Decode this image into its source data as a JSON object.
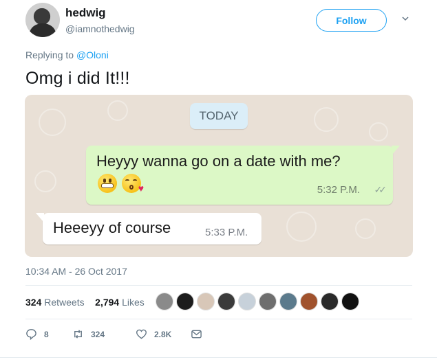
{
  "author": {
    "name": "hedwig",
    "handle": "@iamnothedwig",
    "follow_label": "Follow"
  },
  "reply": {
    "prefix": "Replying to ",
    "mention": "@Oloni"
  },
  "tweet_text": "Omg i did It!!!",
  "chat": {
    "date_chip": "TODAY",
    "outgoing_message": "Heyyy wanna go on a date with me?",
    "outgoing_time": "5:32 P.M.",
    "outgoing_ticks": "✓✓",
    "incoming_message": "Heeeyy of course",
    "incoming_time": "5:33 P.M."
  },
  "timestamp": "10:34 AM - 26 Oct 2017",
  "stats": {
    "retweets_count": "324",
    "retweets_label": "Retweets",
    "likes_count": "2,794",
    "likes_label": "Likes"
  },
  "actions": {
    "reply_count": "8",
    "retweet_count": "324",
    "like_count": "2.8K"
  },
  "colors": {
    "accent": "#1da1f2",
    "chat_background": "#e9e0d6",
    "outgoing_bubble": "#dcf8c6",
    "incoming_bubble": "#ffffff"
  },
  "icons": [
    "chevron-down-icon",
    "grimace-emoji-icon",
    "kiss-emoji-icon",
    "double-check-icon",
    "reply-icon",
    "retweet-icon",
    "heart-icon",
    "message-icon"
  ]
}
